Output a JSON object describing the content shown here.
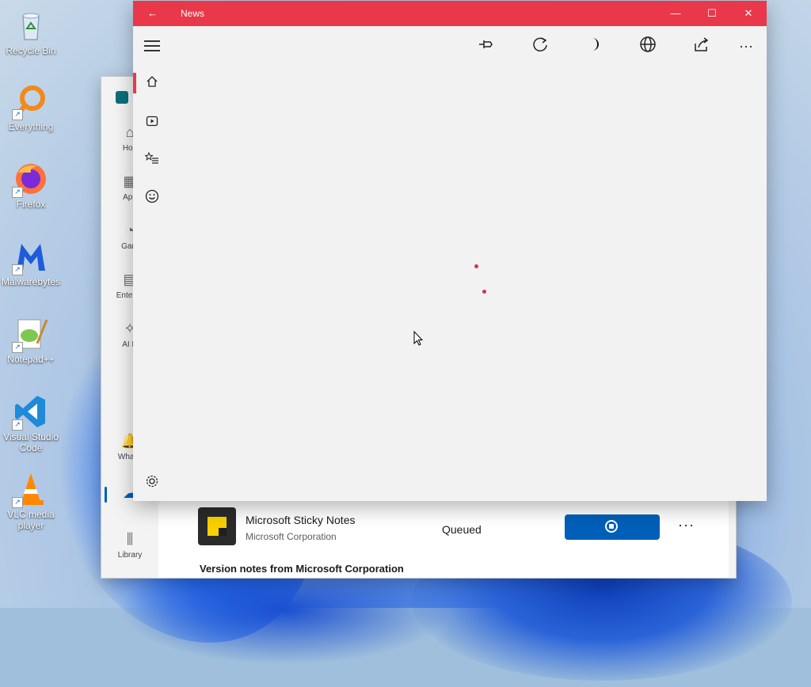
{
  "desktop": {
    "icons": [
      {
        "label": "Recycle Bin",
        "icon": "recycle-bin-icon"
      },
      {
        "label": "Everything",
        "icon": "search-magnifier-icon"
      },
      {
        "label": "Firefox",
        "icon": "firefox-icon"
      },
      {
        "label": "Malwarebytes",
        "icon": "malwarebytes-icon"
      },
      {
        "label": "Notepad++",
        "icon": "notepad-plus-plus-icon"
      },
      {
        "label": "Visual Studio Code",
        "icon": "vscode-icon"
      },
      {
        "label": "VLC media player",
        "icon": "vlc-cone-icon"
      }
    ]
  },
  "store": {
    "nav": [
      {
        "label": "Hon",
        "icon": "home-icon"
      },
      {
        "label": "App",
        "icon": "apps-icon"
      },
      {
        "label": "Gam",
        "icon": "gaming-icon"
      },
      {
        "label": "Entertai",
        "icon": "entertainment-icon"
      },
      {
        "label": "AI H",
        "icon": "ai-hub-icon"
      },
      {
        "label": "What's",
        "icon": "whats-new-icon"
      },
      {
        "label": "",
        "icon": "downloads-cloud-icon"
      },
      {
        "label": "Library",
        "icon": "library-icon"
      }
    ],
    "download": {
      "app_name": "Microsoft Sticky Notes",
      "publisher": "Microsoft Corporation",
      "status": "Queued",
      "more": "···"
    },
    "version_notes": "Version notes from Microsoft Corporation",
    "accent": "#005fb8"
  },
  "news": {
    "title": "News",
    "back": "←",
    "controls": {
      "minimize": "—",
      "maximize": "☐",
      "close": "✕"
    },
    "toolbar": [
      "pin-icon",
      "refresh-icon",
      "dark-mode-icon",
      "language-globe-icon",
      "share-icon",
      "more-icon"
    ],
    "sidebar": [
      "home-icon",
      "video-icon",
      "following-icon",
      "interests-smiley-icon",
      "settings-gear-icon"
    ],
    "accent": "#e8384a"
  }
}
